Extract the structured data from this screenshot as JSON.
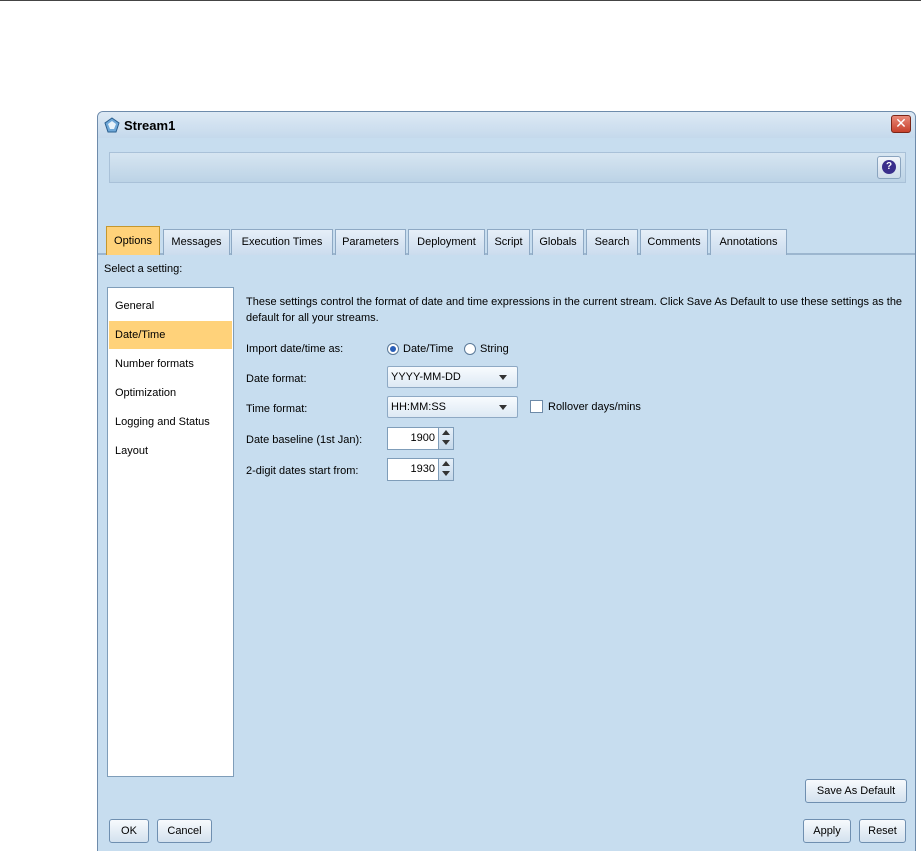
{
  "window": {
    "title": "Stream1"
  },
  "tabs": [
    {
      "label": "Options",
      "active": true
    },
    {
      "label": "Messages",
      "active": false
    },
    {
      "label": "Execution Times",
      "active": false
    },
    {
      "label": "Parameters",
      "active": false
    },
    {
      "label": "Deployment",
      "active": false
    },
    {
      "label": "Script",
      "active": false
    },
    {
      "label": "Globals",
      "active": false
    },
    {
      "label": "Search",
      "active": false
    },
    {
      "label": "Comments",
      "active": false
    },
    {
      "label": "Annotations",
      "active": false
    }
  ],
  "settings": {
    "label": "Select a setting:",
    "items": [
      "General",
      "Date/Time",
      "Number formats",
      "Optimization",
      "Logging and Status",
      "Layout"
    ],
    "selected": "Date/Time"
  },
  "datetime": {
    "description": "These settings control the format of date and time expressions in the current stream. Click Save As Default to use these settings as the default for all your streams.",
    "import_label": "Import date/time as:",
    "import_options": [
      "Date/Time",
      "String"
    ],
    "import_selected": "Date/Time",
    "date_format_label": "Date format:",
    "date_format_value": "YYYY-MM-DD",
    "time_format_label": "Time format:",
    "time_format_value": "HH:MM:SS",
    "rollover_label": "Rollover days/mins",
    "rollover_checked": false,
    "baseline_label": "Date baseline (1st Jan):",
    "baseline_value": "1900",
    "twodigit_label": "2-digit dates start from:",
    "twodigit_value": "1930"
  },
  "buttons": {
    "save_default": "Save As Default",
    "ok": "OK",
    "cancel": "Cancel",
    "apply": "Apply",
    "reset": "Reset"
  },
  "icons": {
    "app": "stream-icon",
    "close": "close-icon",
    "help": "help-icon"
  }
}
